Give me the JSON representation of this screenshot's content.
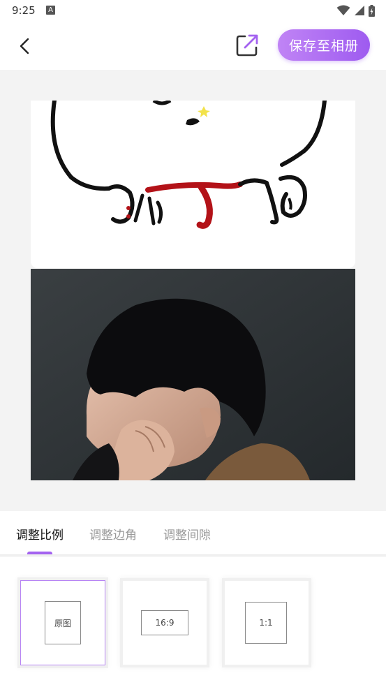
{
  "status_bar": {
    "time": "9:25",
    "badge": "A"
  },
  "header": {
    "back_icon": "chevron-left-icon",
    "share_icon": "share-external-icon",
    "save_label": "保存至相册",
    "accent": "#a463f0"
  },
  "tabs": [
    {
      "label": "调整比例",
      "active": true
    },
    {
      "label": "调整边角",
      "active": false
    },
    {
      "label": "调整间隙",
      "active": false
    }
  ],
  "ratio_options": [
    {
      "label": "原图",
      "selected": true
    },
    {
      "label": "16:9",
      "selected": false
    },
    {
      "label": "1:1",
      "selected": false
    }
  ]
}
